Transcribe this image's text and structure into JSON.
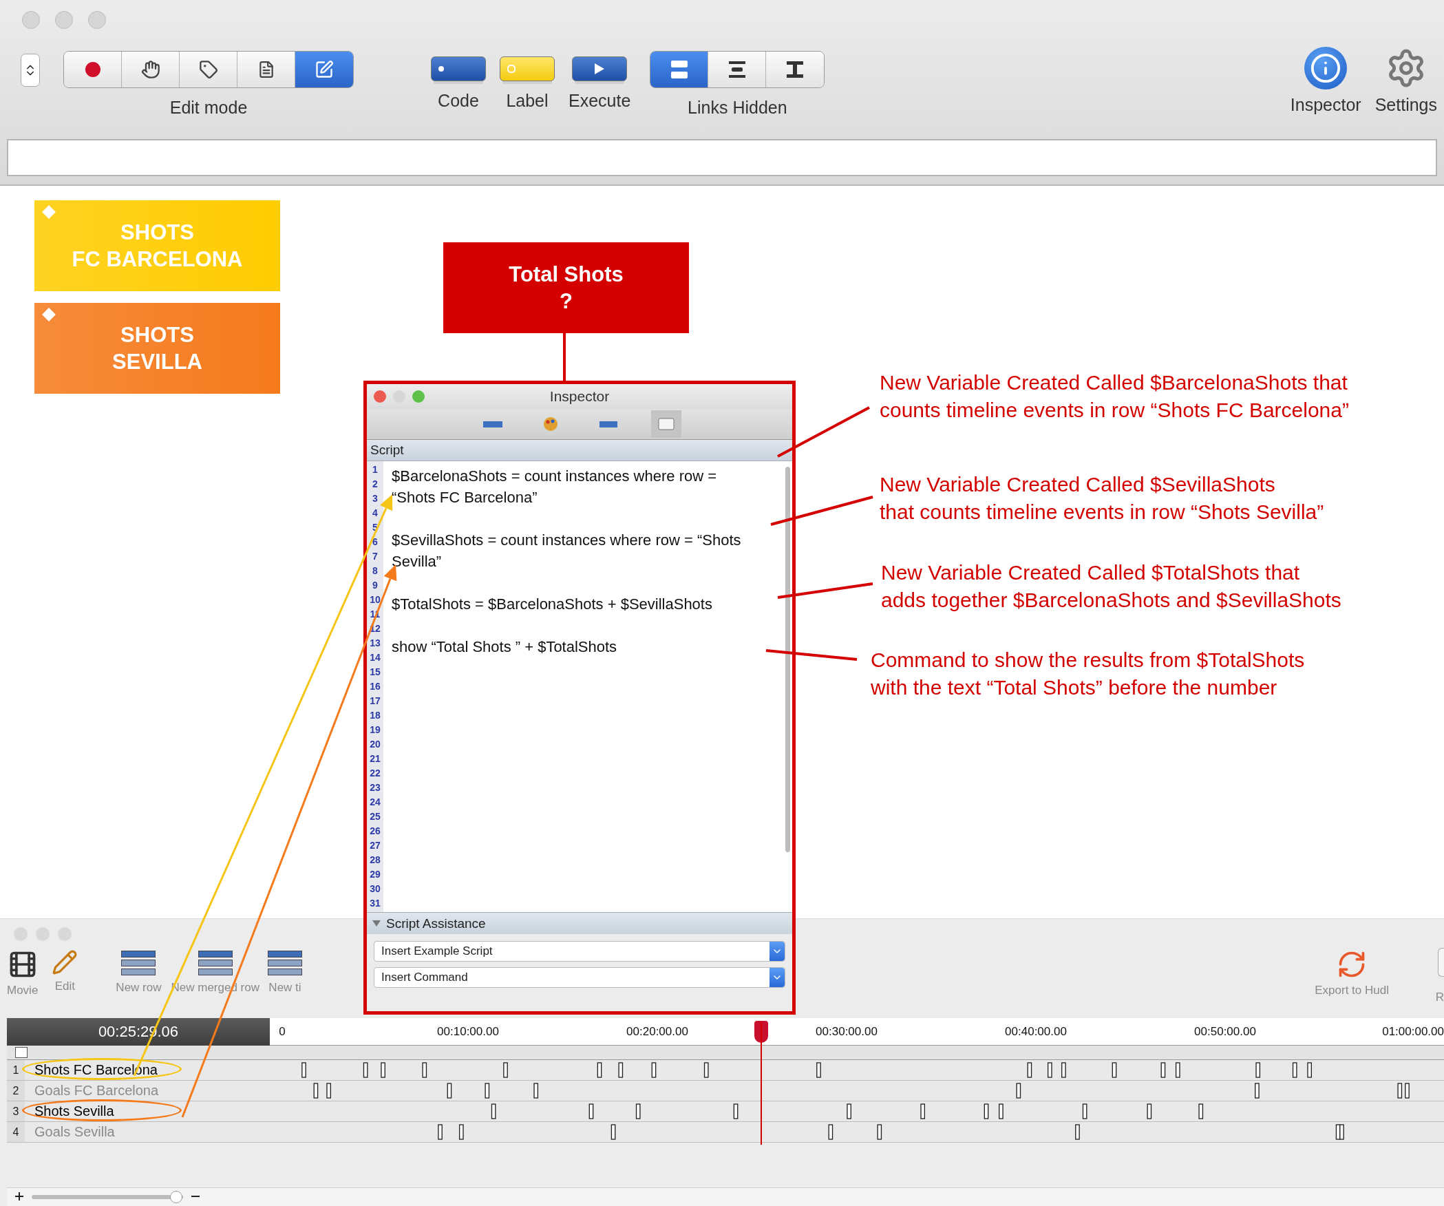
{
  "toolbar": {
    "edit_mode": {
      "label": "Edit mode",
      "tools": [
        {
          "kind": "record",
          "selected": false
        },
        {
          "kind": "hand",
          "selected": false
        },
        {
          "kind": "tag",
          "selected": false
        },
        {
          "kind": "document",
          "selected": false
        },
        {
          "kind": "edit",
          "selected": true
        }
      ]
    },
    "buttons": [
      {
        "kind": "code",
        "label": "Code"
      },
      {
        "kind": "label",
        "label": "Label"
      },
      {
        "kind": "execute",
        "label": "Execute"
      }
    ],
    "links": {
      "label": "Links Hidden",
      "options": [
        {
          "kind": "stacked",
          "selected": true
        },
        {
          "kind": "middle",
          "selected": false
        },
        {
          "kind": "linked",
          "selected": false
        }
      ]
    },
    "right_buttons": [
      {
        "kind": "inspector",
        "label": "Inspector"
      },
      {
        "kind": "settings",
        "label": "Settings"
      }
    ]
  },
  "canvas": {
    "nodes": [
      {
        "kind": "label",
        "lines": [
          "SHOTS",
          "FC BARCELONA"
        ],
        "color": "#ffcc00"
      },
      {
        "kind": "label",
        "lines": [
          "SHOTS",
          "SEVILLA"
        ],
        "color": "#f57a1c"
      },
      {
        "kind": "code",
        "lines": [
          "Total Shots",
          "?"
        ],
        "color": "#d40000"
      }
    ]
  },
  "inspector": {
    "title": "Inspector",
    "script_label": "Script",
    "tabs": [
      {
        "kind": "bar",
        "selected": false
      },
      {
        "kind": "palette",
        "selected": false
      },
      {
        "kind": "field",
        "selected": false
      },
      {
        "kind": "script",
        "selected": true
      }
    ],
    "line_numbers": [
      "1",
      "2",
      "3",
      "4",
      "5",
      "6",
      "7",
      "8",
      "9",
      "10",
      "11",
      "12",
      "13",
      "14",
      "15",
      "16",
      "17",
      "18",
      "19",
      "20",
      "21",
      "22",
      "23",
      "24",
      "25",
      "26",
      "27",
      "28",
      "29",
      "30",
      "31"
    ],
    "script": [
      "$BarcelonaShots = count instances where row = “Shots FC Barcelona”",
      "$SevillaShots = count instances where row = “Shots Sevilla”",
      "$TotalShots = $BarcelonaShots + $SevillaShots",
      "show “Total Shots ” + $TotalShots"
    ],
    "assistance": {
      "label": "Script Assistance",
      "expanded": true,
      "dropdowns": [
        "Insert Example Script",
        "Insert Command"
      ]
    }
  },
  "annotations": [
    {
      "lines": [
        "New Variable Created Called $BarcelonaShots that",
        "counts timeline events in row “Shots FC Barcelona”"
      ]
    },
    {
      "lines": [
        "New Variable Created Called $SevillaShots",
        "that counts timeline events in row “Shots Sevilla”"
      ]
    },
    {
      "lines": [
        "New Variable Created Called $TotalShots that",
        "adds together $BarcelonaShots and $SevillaShots"
      ]
    },
    {
      "lines": [
        "Command to show the results from $TotalShots",
        "with the text “Total Shots” before the number"
      ]
    }
  ],
  "timeline_window": {
    "tools": [
      {
        "kind": "movie",
        "label": "Movie"
      },
      {
        "kind": "edit",
        "label": "Edit"
      },
      {
        "kind": "new_row",
        "label": "New row"
      },
      {
        "kind": "merged_row",
        "label": "New merged row"
      },
      {
        "kind": "new_timeline",
        "label": "New ti"
      }
    ],
    "export": {
      "label": "Export to Hudl"
    },
    "edge_label": "R",
    "time": "00:25:29.06",
    "select_all": {
      "checked": false
    },
    "zoom": {
      "level": 0.95
    },
    "ticks": [
      "0",
      "00:10:00.00",
      "00:20:00.00",
      "00:30:00.00",
      "00:40:00.00",
      "00:50:00.00",
      "01:00:00.00"
    ],
    "rows": [
      {
        "number": "1",
        "name": "Shots FC Barcelona",
        "highlighted": true,
        "color": "#f5c518"
      },
      {
        "number": "2",
        "name": "Goals FC Barcelona",
        "highlighted": false
      },
      {
        "number": "3",
        "name": "Shots Sevilla",
        "highlighted": true,
        "color": "#f57a1c"
      },
      {
        "number": "4",
        "name": "Goals Sevilla",
        "highlighted": false
      }
    ]
  }
}
